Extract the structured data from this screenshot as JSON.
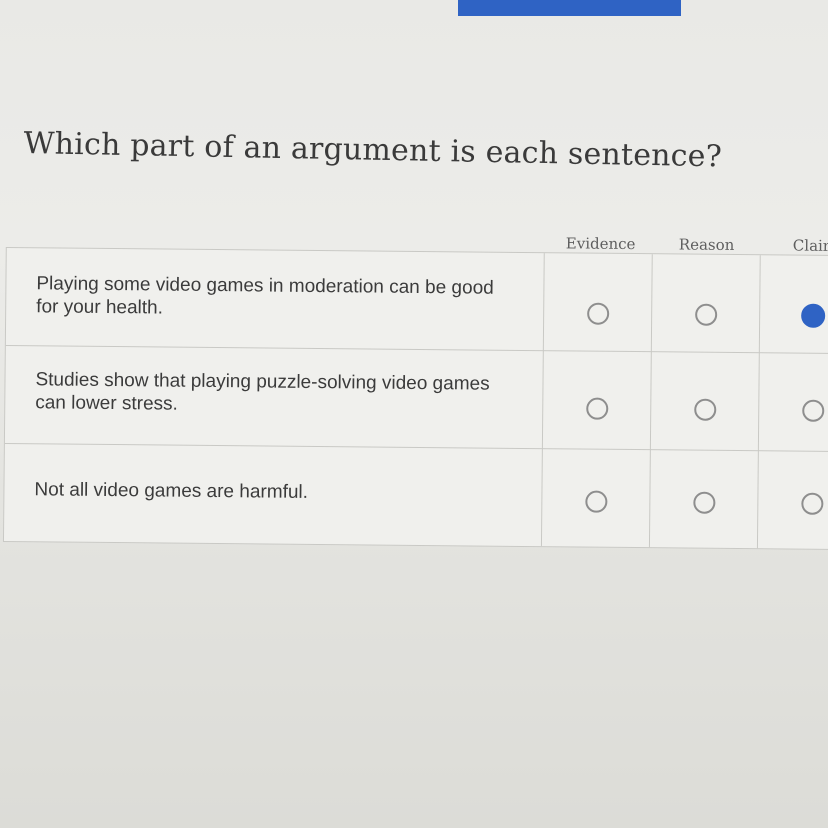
{
  "question": "Which part of an argument is each sentence?",
  "columns": [
    "Evidence",
    "Reason",
    "Clair"
  ],
  "rows": [
    {
      "label": "Playing some video games in moderation can be good for your health.",
      "selected": "Clair"
    },
    {
      "label": "Studies show that playing puzzle-solving video games can lower stress.",
      "selected": null
    },
    {
      "label": "Not all video games are harmful.",
      "selected": null
    }
  ],
  "colors": {
    "accent": "#2f63c4",
    "radio_border": "#8e8e8e",
    "text": "#3b3b3b"
  }
}
